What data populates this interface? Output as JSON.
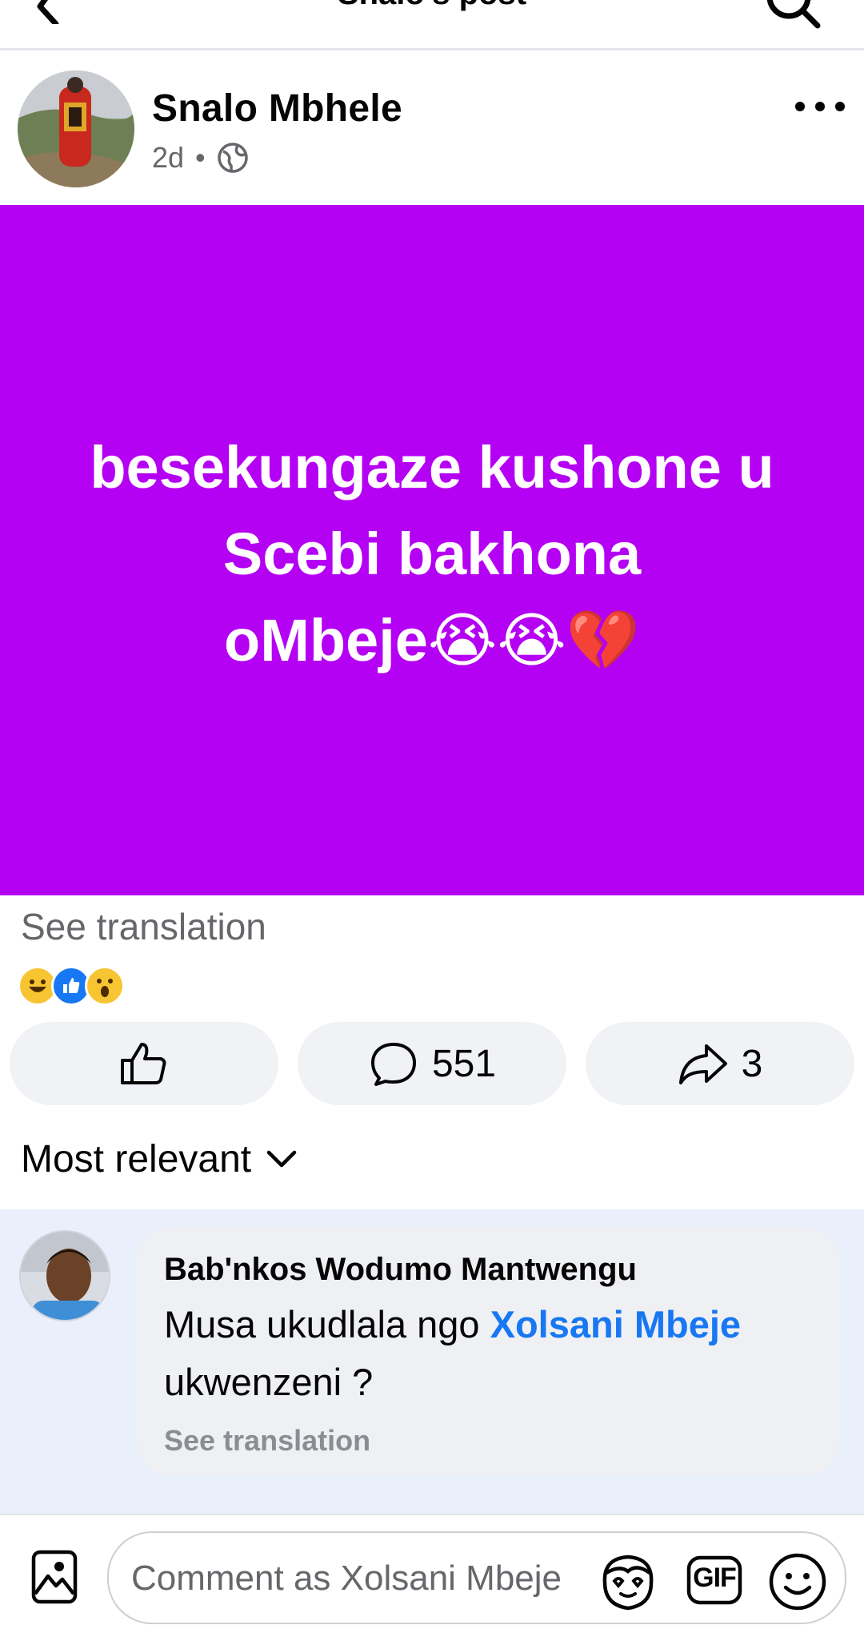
{
  "header": {
    "title": "Snalo's post"
  },
  "post": {
    "author": "Snalo Mbhele",
    "time": "2d",
    "separator": "•",
    "background_color": "#b400f3",
    "text_line1": "besekungaze kushone u",
    "text_line2": "Scebi bakhona",
    "text_line3": "oMbeje😭😭💔",
    "see_translation": "See translation",
    "reactions": [
      "haha",
      "like",
      "wow"
    ]
  },
  "actions": {
    "comment_count": "551",
    "share_count": "3"
  },
  "sort": {
    "label": "Most relevant"
  },
  "comment": {
    "author": "Bab'nkos Wodumo Mantwengu",
    "text_before": "Musa ukudlala ngo ",
    "mention": "Xolsani Mbeje",
    "text_after": " ukwenzeni ?",
    "see_translation": "See translation"
  },
  "composer": {
    "placeholder": "Comment as Xolsani Mbeje",
    "gif_label": "GIF"
  },
  "colors": {
    "accent": "#1877f2",
    "post_bg": "#b400f3",
    "comment_highlight": "#e9f0fb"
  }
}
